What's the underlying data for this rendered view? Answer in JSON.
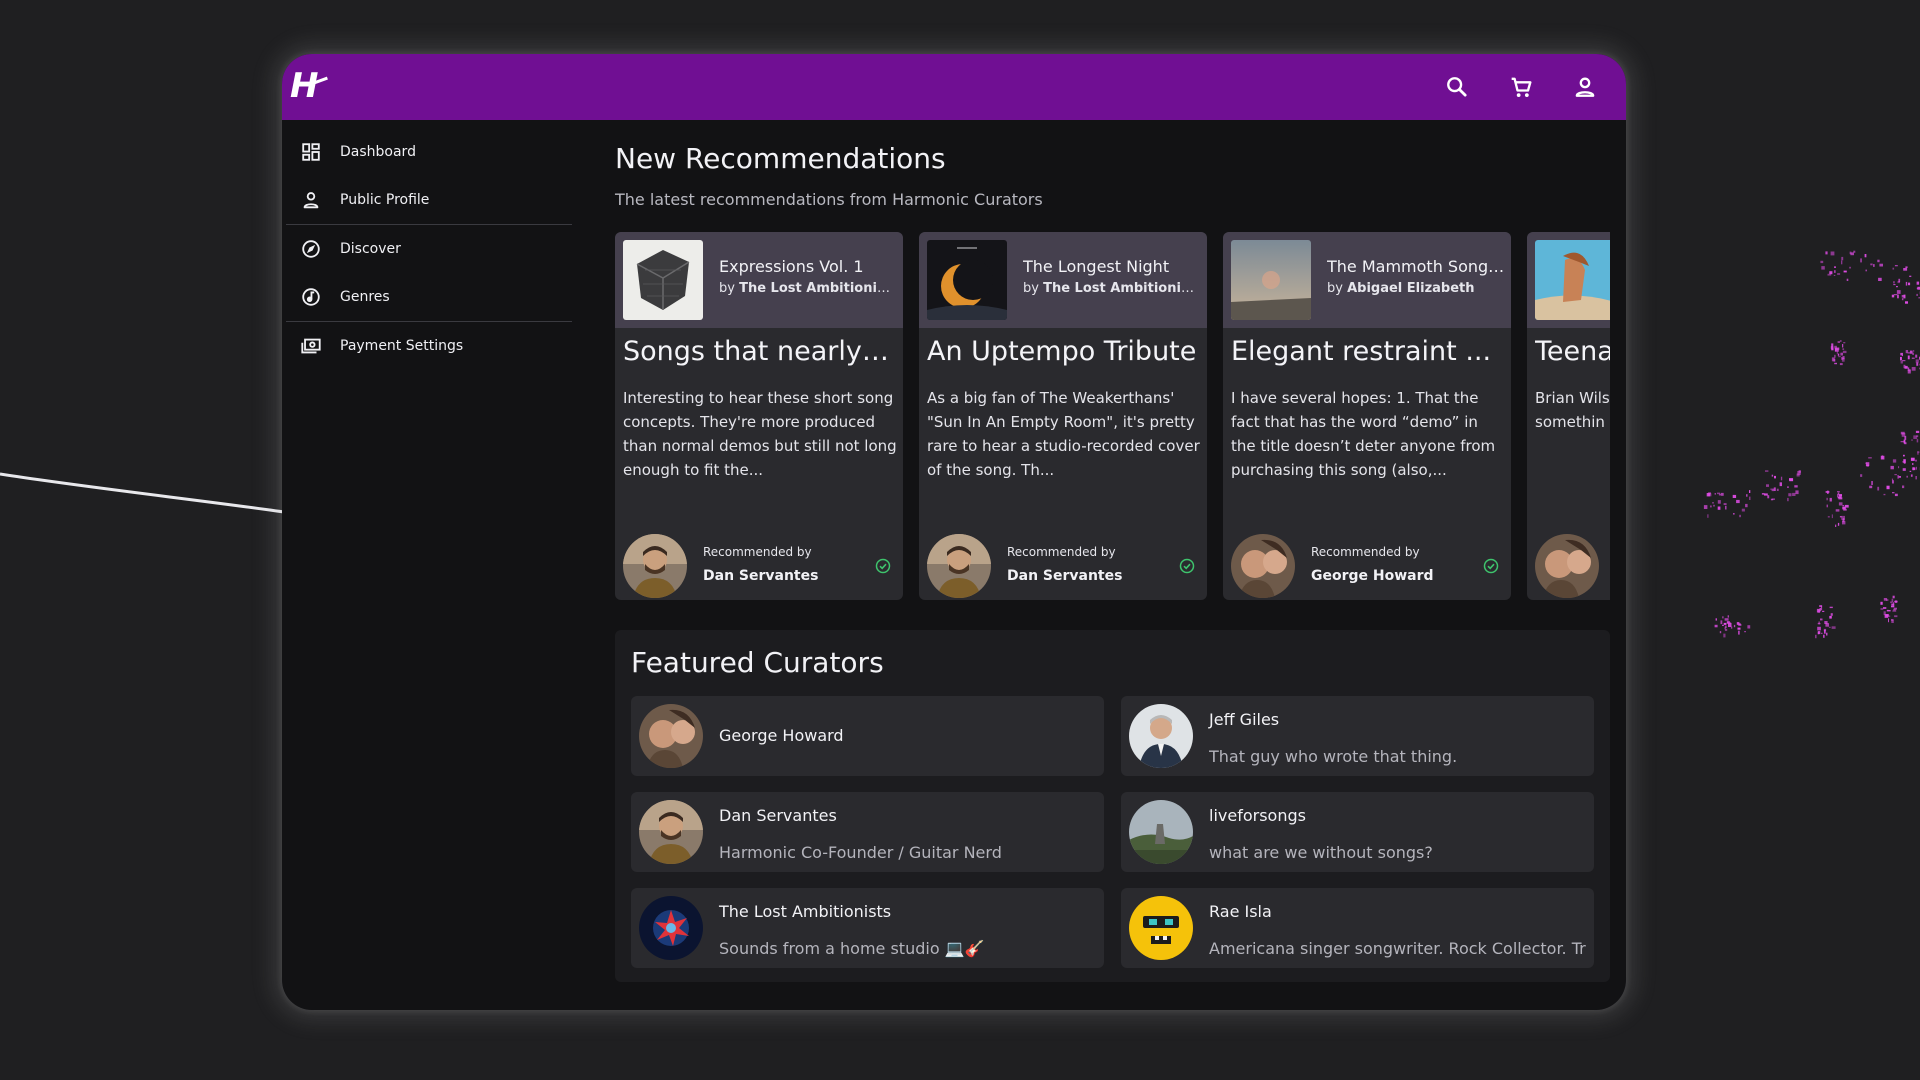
{
  "app": {
    "logo_text": "H"
  },
  "topbar": {
    "icons": [
      "search-icon",
      "cart-icon",
      "account-icon"
    ]
  },
  "sidebar": {
    "items": [
      {
        "label": "Dashboard",
        "icon": "dashboard-icon"
      },
      {
        "label": "Public Profile",
        "icon": "person-icon"
      },
      {
        "label": "Discover",
        "icon": "compass-icon"
      },
      {
        "label": "Genres",
        "icon": "music-note-icon"
      },
      {
        "label": "Payment Settings",
        "icon": "payments-icon"
      }
    ]
  },
  "recommendations": {
    "title": "New Recommendations",
    "subtitle": "The latest recommendations from Harmonic Curators",
    "recommended_by_label": "Recommended by",
    "cards": [
      {
        "album": "Expressions Vol. 1",
        "by": "by",
        "artist": "The Lost Ambitionists",
        "title": "Songs that nearly make it",
        "body": "Interesting to hear these short song concepts. They're more produced than normal demos but still not long enough to fit the...",
        "curator": "Dan Servantes"
      },
      {
        "album": "The Longest Night",
        "by": "by",
        "artist": "The Lost Ambitionists",
        "title": "An Uptempo Tribute",
        "body": "As a big fan of The Weakerthans' \"Sun In An Empty Room\", it's pretty rare to hear a studio-recorded cover of the song. Th...",
        "curator": "Dan Servantes"
      },
      {
        "album": "The Mammoth Song Demo",
        "by": "by",
        "artist": "Abigael Elizabeth",
        "title": "Elegant restraint ...",
        "body": "I have several hopes: 1. That the fact that has the word “demo” in the title doesn’t deter anyone from purchasing this song (also,...",
        "curator": "George Howard"
      },
      {
        "album": "",
        "by": "",
        "artist": "",
        "title": "Teena",
        "body": "Brian Wils he (parap symphoni somethin",
        "curator": ""
      }
    ]
  },
  "featured": {
    "title": "Featured Curators",
    "curators": [
      {
        "name": "George Howard",
        "desc": ""
      },
      {
        "name": "Jeff Giles",
        "desc": "That guy who wrote that thing."
      },
      {
        "name": "Dan Servantes",
        "desc": "Harmonic Co-Founder / Guitar Nerd"
      },
      {
        "name": "liveforsongs",
        "desc": "what are we without songs?"
      },
      {
        "name": "The Lost Ambitionists",
        "desc": "Sounds from a home studio 💻🎸"
      },
      {
        "name": "Rae Isla",
        "desc": "Americana singer songwriter. Rock Collector. Tr"
      }
    ]
  },
  "colors": {
    "topbar": "#700f93",
    "app_bg": "#121214",
    "card_bg": "#2a2a2e",
    "card_head": "#45404e",
    "check": "#3ec46d",
    "confetti": "#e04ce6"
  }
}
